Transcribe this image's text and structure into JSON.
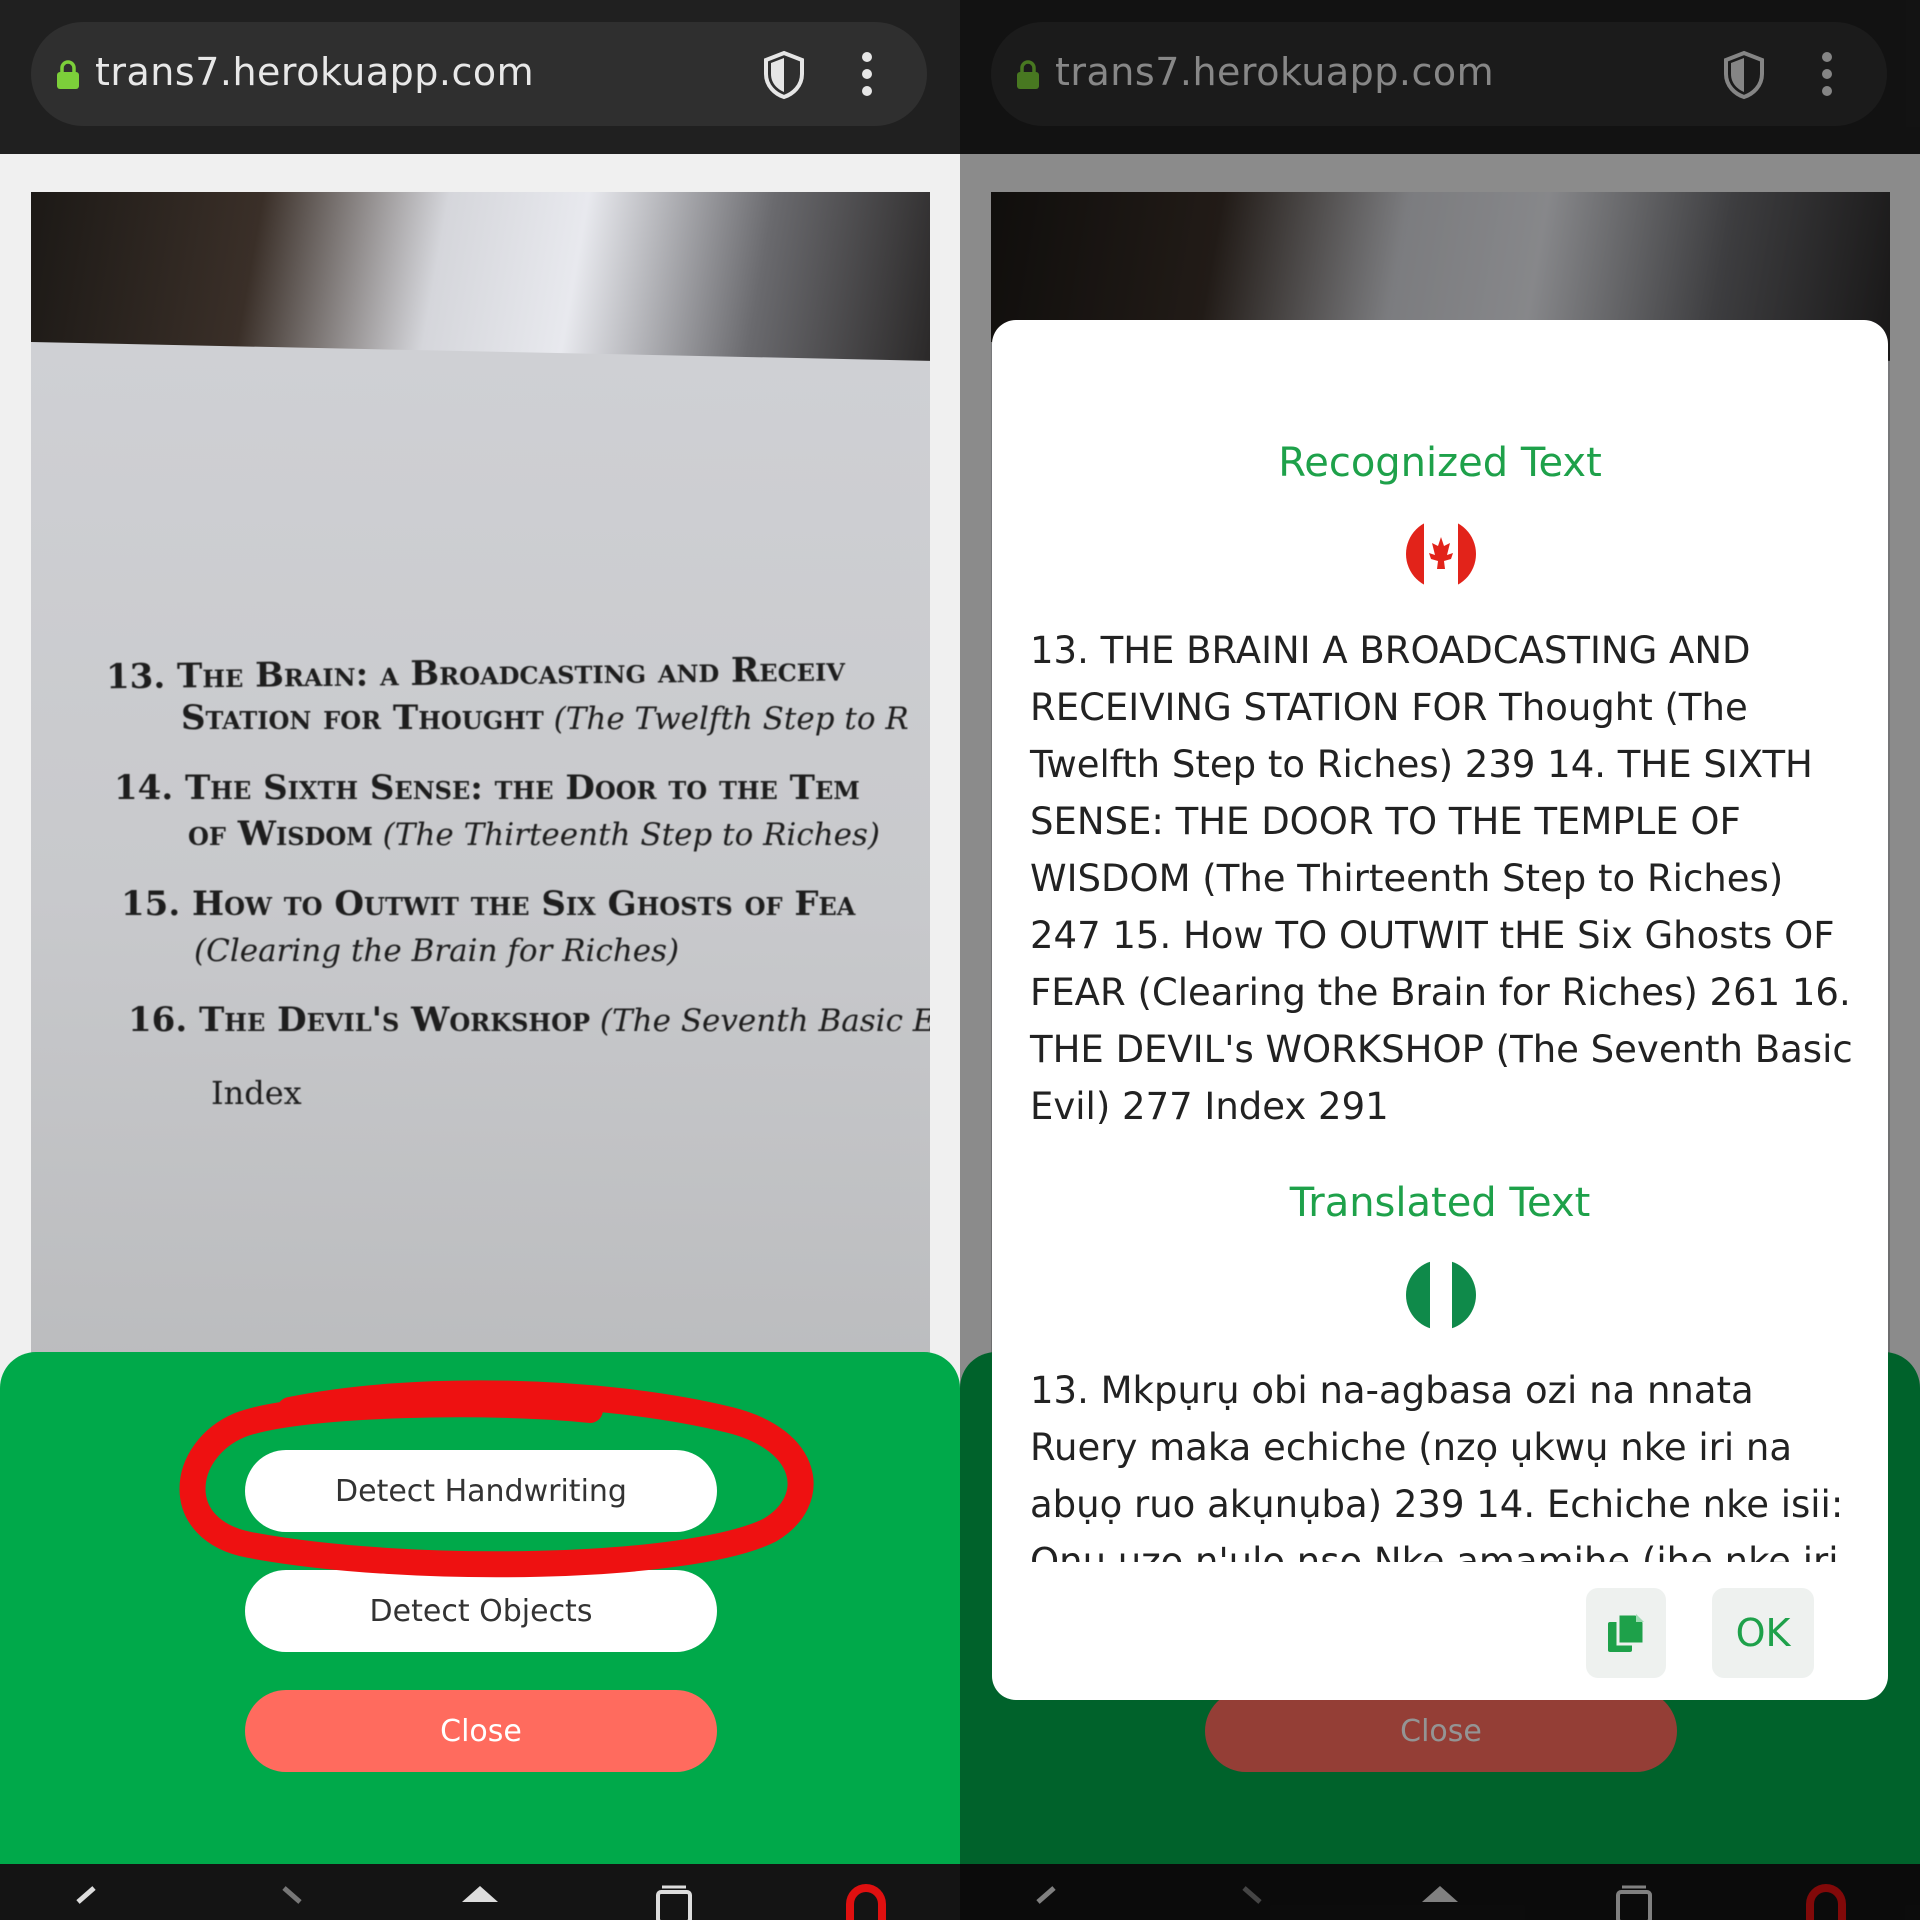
{
  "browser": {
    "url": "trans7.herokuapp.com"
  },
  "left": {
    "photo_text": {
      "lines": [
        {
          "main": "13. The Brain: a Broadcasting and Receiv",
          "sub": ""
        },
        {
          "main": "Station for Thought",
          "sub": " (The Twelfth Step to R"
        },
        {
          "main": "14. The Sixth Sense: the Door to the Tem",
          "sub": ""
        },
        {
          "main": "of Wisdom",
          "sub": " (The Thirteenth Step to Riches)"
        },
        {
          "main": "15. How to Outwit the Six Ghosts of Fea",
          "sub": ""
        },
        {
          "main": "",
          "sub": "(Clearing the Brain for Riches)"
        },
        {
          "main": "16. The Devil's Workshop",
          "sub": " (The Seventh Basic E"
        }
      ],
      "index": "Index"
    },
    "buttons": {
      "detect_handwriting": "Detect Handwriting",
      "detect_objects": "Detect Objects",
      "close": "Close"
    },
    "colors": {
      "sheet": "#00a94a",
      "close": "#ff6b5e",
      "annotation": "#ee1111"
    }
  },
  "right": {
    "modal": {
      "recognized_title": "Recognized Text",
      "recognized_flag": "canada-flag-icon",
      "recognized_text": "13. THE BRAINI A BROADCASTING AND RECEIVING STATION FOR Thought (The Twelfth Step to Riches) 239 14. THE SIXTH SENSE: THE DOOR TO THE TEMPLE OF WISDOM (The Thirteenth Step to Riches) 247 15. How TO OUTWIT tHE Six Ghosts OF FEAR (Clearing the Brain for Riches) 261 16. THE DEVIL's WORKSHOP (The Seventh Basic Evil) 277 Index 291",
      "translated_title": "Translated Text",
      "translated_flag": "nigeria-flag-icon",
      "translated_text": "13. Mkpụrụ obi na-agbasa ozi na nnata Ruery maka echiche (nzọ ụkwụ nke iri na abụọ ruo akụnụba) 239 14. Echiche nke isii: Ọnụ ụzọ n'ụlọ nsọ Nke amamihe (ihe nke iri",
      "ok_label": "OK",
      "copy_icon": "copy-icon"
    },
    "background_close": "Close",
    "colors": {
      "title": "#1ea14a"
    }
  }
}
